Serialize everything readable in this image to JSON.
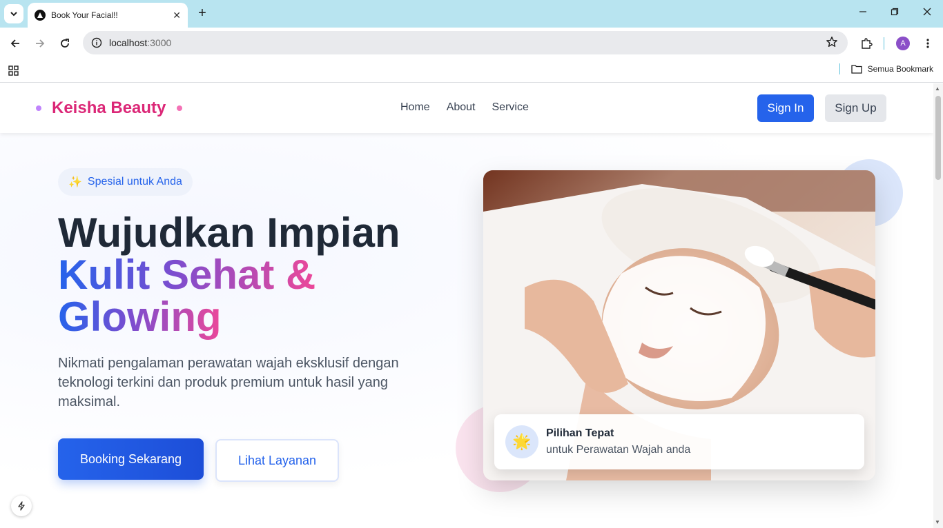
{
  "browser": {
    "tab_title": "Book Your Facial!!",
    "new_tab_symbol": "+",
    "close_symbol": "✕",
    "url_host": "localhost",
    "url_port": ":3000",
    "bookmarks_label": "Semua Bookmark",
    "profile_initial": "A"
  },
  "header": {
    "brand": "Keisha Beauty",
    "nav": [
      "Home",
      "About",
      "Service"
    ],
    "sign_in": "Sign In",
    "sign_up": "Sign Up"
  },
  "hero": {
    "badge_icon": "✨",
    "badge": "Spesial untuk Anda",
    "title_line1": "Wujudkan Impian",
    "title_line2": "Kulit Sehat &",
    "title_line3": "Glowing",
    "description": "Nikmati pengalaman perawatan wajah eksklusif dengan teknologi terkini dan produk premium untuk hasil yang maksimal.",
    "primary_cta": "Booking Sekarang",
    "secondary_cta": "Lihat Layanan"
  },
  "card": {
    "icon": "🌟",
    "title": "Pilihan Tepat",
    "subtitle": "untuk Perawatan Wajah anda"
  },
  "colors": {
    "brand_pink": "#db2777",
    "primary_blue": "#2563eb",
    "gradient": [
      "#2563eb",
      "#7c4dcf",
      "#ec4899"
    ]
  }
}
